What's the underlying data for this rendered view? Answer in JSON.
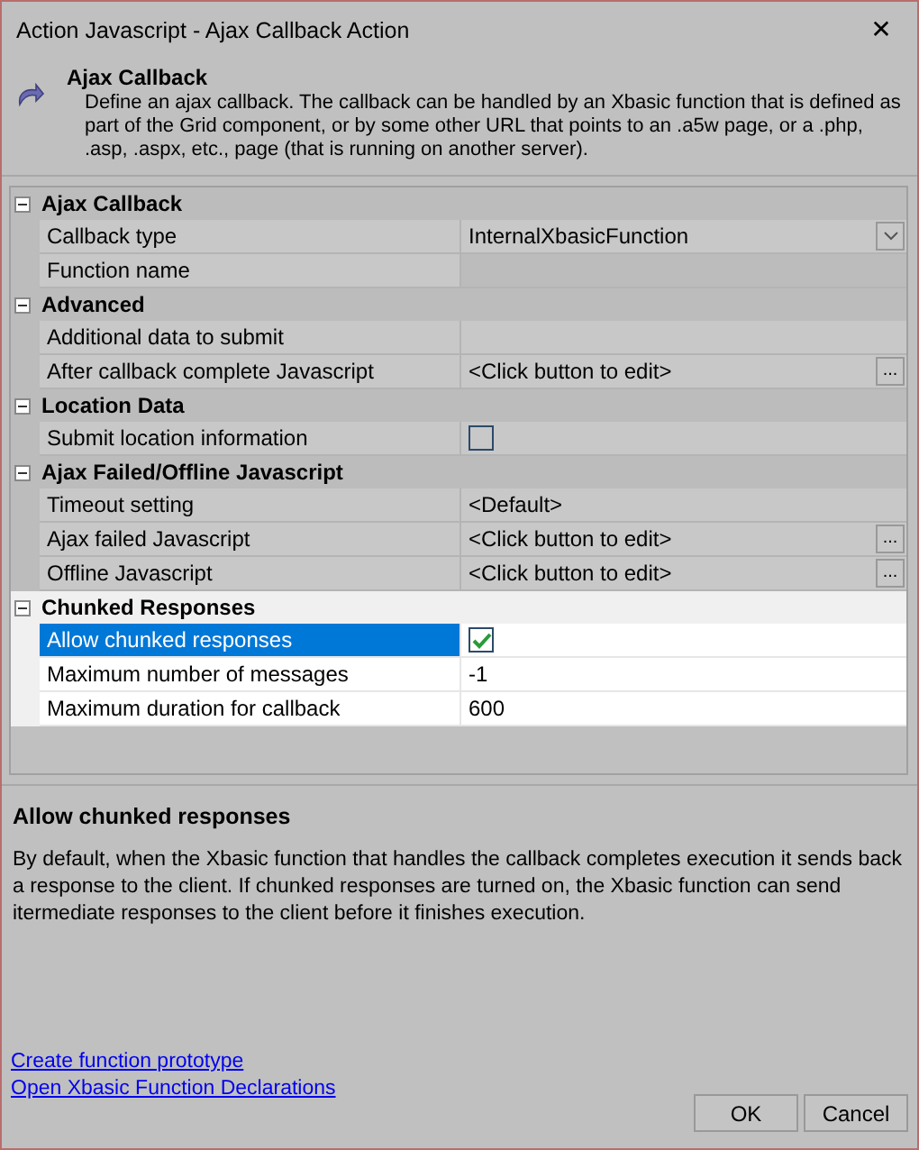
{
  "window": {
    "title": "Action Javascript - Ajax Callback Action",
    "close": "✕"
  },
  "header": {
    "title": "Ajax Callback",
    "description": "Define an ajax callback. The callback can be handled by an Xbasic function that is defined as part of the Grid component, or by some other URL that points to an .a5w page, or a .php, .asp, .aspx, etc., page (that is running on another server)."
  },
  "sections": [
    {
      "title": "Ajax Callback",
      "expanded": true,
      "highlighted": false,
      "rows": [
        {
          "label": "Callback type",
          "kind": "dropdown",
          "value": "InternalXbasicFunction",
          "selected": false
        },
        {
          "label": "Function name",
          "kind": "none",
          "selected": false
        }
      ]
    },
    {
      "title": "Advanced",
      "expanded": true,
      "highlighted": false,
      "rows": [
        {
          "label": "Additional data to submit",
          "kind": "text",
          "selected": false
        },
        {
          "label": "After callback complete Javascript",
          "kind": "edit",
          "value": "<Click button to edit>",
          "button": "...",
          "selected": false
        }
      ]
    },
    {
      "title": "Location Data",
      "expanded": true,
      "highlighted": false,
      "rows": [
        {
          "label": "Submit location information",
          "kind": "checkbox",
          "checked": false,
          "selected": false
        }
      ]
    },
    {
      "title": "Ajax Failed/Offline Javascript",
      "expanded": true,
      "highlighted": false,
      "rows": [
        {
          "label": "Timeout setting",
          "kind": "text",
          "value": "<Default>",
          "selected": false
        },
        {
          "label": "Ajax failed Javascript",
          "kind": "edit",
          "value": "<Click button to edit>",
          "button": "...",
          "selected": false
        },
        {
          "label": "Offline Javascript",
          "kind": "edit",
          "value": "<Click button to edit>",
          "button": "...",
          "selected": false
        }
      ]
    },
    {
      "title": "Chunked Responses",
      "expanded": true,
      "highlighted": true,
      "rows": [
        {
          "label": "Allow chunked responses",
          "kind": "checkbox",
          "checked": true,
          "selected": true
        },
        {
          "label": "Maximum number of messages",
          "kind": "text",
          "value": "-1",
          "selected": false
        },
        {
          "label": "Maximum duration for callback",
          "kind": "text",
          "value": "600",
          "selected": false
        }
      ]
    }
  ],
  "help": {
    "title": "Allow chunked responses",
    "text": "By default, when the Xbasic function that handles the callback completes execution it sends back a response to the client. If chunked responses are turned on, the Xbasic function can send itermediate responses to the client before it finishes execution."
  },
  "links": [
    "Create function prototype",
    "Open Xbasic Function Declarations"
  ],
  "buttons": [
    "OK",
    "Cancel"
  ]
}
